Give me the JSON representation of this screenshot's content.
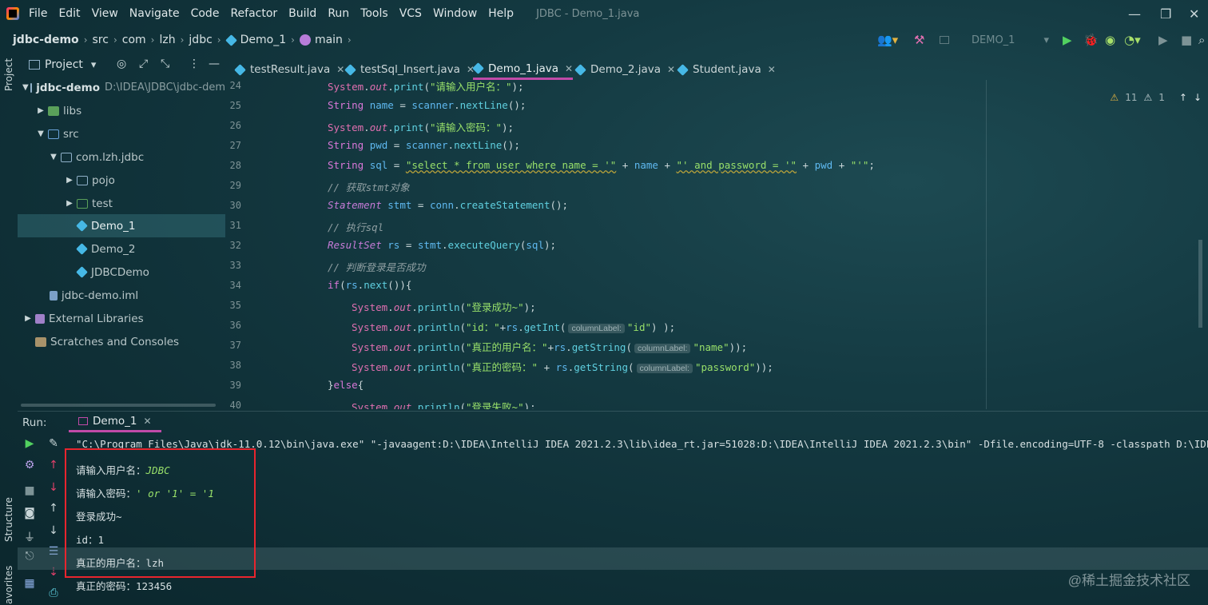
{
  "menu": {
    "items": [
      "File",
      "Edit",
      "View",
      "Navigate",
      "Code",
      "Refactor",
      "Build",
      "Run",
      "Tools",
      "VCS",
      "Window",
      "Help"
    ],
    "window_title": "JDBC - Demo_1.java"
  },
  "breadcrumb": [
    "jdbc-demo",
    "src",
    "com",
    "lzh",
    "jdbc",
    "Demo_1",
    "main"
  ],
  "run_config": {
    "name": "DEMO_1"
  },
  "project": {
    "title": "Project",
    "tree": [
      {
        "label": "jdbc-demo",
        "path": "D:\\IDEA\\JDBC\\jdbc-dem"
      },
      {
        "label": "libs"
      },
      {
        "label": "src"
      },
      {
        "label": "com.lzh.jdbc"
      },
      {
        "label": "pojo"
      },
      {
        "label": "test"
      },
      {
        "label": "Demo_1"
      },
      {
        "label": "Demo_2"
      },
      {
        "label": "JDBCDemo"
      },
      {
        "label": "jdbc-demo.iml"
      },
      {
        "label": "External Libraries"
      },
      {
        "label": "Scratches and Consoles"
      }
    ]
  },
  "side_tools": {
    "project": "Project",
    "structure": "Structure",
    "favorites": "avorites"
  },
  "tabs": [
    "testResult.java",
    "testSql_Insert.java",
    "Demo_1.java",
    "Demo_2.java",
    "Student.java"
  ],
  "active_tab": "Demo_1.java",
  "editor": {
    "line_numbers": [
      "24",
      "25",
      "26",
      "27",
      "28",
      "29",
      "30",
      "31",
      "32",
      "33",
      "34",
      "35",
      "36",
      "37",
      "38",
      "39",
      "40"
    ],
    "inlay_hint": "columnLabel:",
    "strings": {
      "s24": "\"请输入用户名：\"",
      "s26": "\"请输入密码：\"",
      "s28a": "\"select * from user where name = '\"",
      "s28b": "\"' and password = '\"",
      "s28c": "\"'\"",
      "c29": "// 获取stmt对象",
      "c31": "// 执行sql",
      "c33": "// 判断登录是否成功",
      "s35": "\"登录成功~\"",
      "s36a": "\"id：\"",
      "s36b": "\"id\"",
      "s37a": "\"真正的用户名：\"",
      "s37b": "\"name\"",
      "s38a": "\"真正的密码：\"",
      "s38b": "\"password\"",
      "s40": "\"登录失败~\""
    }
  },
  "inspections": {
    "warnings": "11",
    "weak": "1"
  },
  "run_panel": {
    "label": "Run:",
    "tab": "Demo_1",
    "command": "\"C:\\Program Files\\Java\\jdk-11.0.12\\bin\\java.exe\" \"-javaagent:D:\\IDEA\\IntelliJ IDEA 2021.2.3\\lib\\idea_rt.jar=51028:D:\\IDEA\\IntelliJ IDEA 2021.2.3\\bin\" -Dfile.encoding=UTF-8 -classpath D:\\IDEA\\",
    "lines": [
      {
        "prompt": "请输入用户名：",
        "input": "JDBC"
      },
      {
        "prompt": "请输入密码：",
        "input": "' or '1' = '1"
      },
      {
        "prompt": "登录成功~",
        "input": ""
      },
      {
        "prompt": "id：1",
        "input": ""
      },
      {
        "prompt": "真正的用户名：lzh",
        "input": ""
      },
      {
        "prompt": "真正的密码：123456",
        "input": ""
      }
    ]
  },
  "watermark": "@稀土掘金技术社区",
  "colors": {
    "highlight_box": "#e8252e",
    "active_tab_underline": "#c04aa8"
  }
}
